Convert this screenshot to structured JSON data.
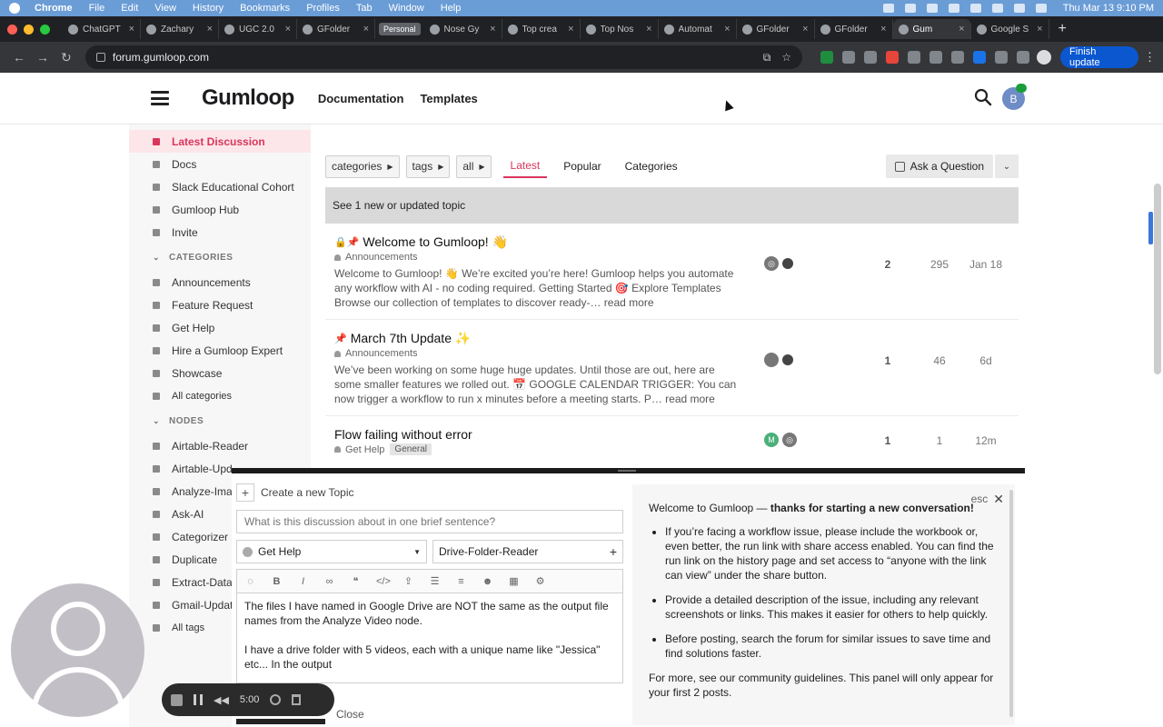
{
  "menubar": {
    "app": "Chrome",
    "items": [
      "File",
      "Edit",
      "View",
      "History",
      "Bookmarks",
      "Profiles",
      "Tab",
      "Window",
      "Help"
    ],
    "clock": "Thu Mar 13  9:10 PM"
  },
  "tabs": [
    {
      "label": "ChatGPT"
    },
    {
      "label": "Zachary"
    },
    {
      "label": "UGC 2.0"
    },
    {
      "label": "GFolder"
    },
    {
      "label": "Nose Gy"
    },
    {
      "label": "Top crea"
    },
    {
      "label": "Top Nos"
    },
    {
      "label": "Automat"
    },
    {
      "label": "GFolder"
    },
    {
      "label": "GFolder"
    },
    {
      "label": "Gum"
    },
    {
      "label": "Google S"
    }
  ],
  "tab_group_label": "Personal",
  "address": {
    "url": "forum.gumloop.com",
    "finish_update": "Finish update"
  },
  "header": {
    "logo": "Gumloop",
    "nav": [
      "Documentation",
      "Templates"
    ],
    "avatar_letter": "B"
  },
  "sidebar": {
    "top_items": [
      {
        "label": "Latest Discussion",
        "active": true
      },
      {
        "label": "Docs"
      },
      {
        "label": "Slack Educational Cohort"
      },
      {
        "label": "Gumloop Hub"
      },
      {
        "label": "Invite"
      }
    ],
    "categories_heading": "CATEGORIES",
    "categories": [
      "Announcements",
      "Feature Request",
      "Get Help",
      "Hire a Gumloop Expert",
      "Showcase"
    ],
    "all_categories": "All categories",
    "nodes_heading": "NODES",
    "nodes": [
      "Airtable-Reader",
      "Airtable-Upd",
      "Analyze-Imag",
      "Ask-AI",
      "Categorizer",
      "Duplicate",
      "Extract-Data",
      "Gmail-Update"
    ],
    "all_tags": "All tags"
  },
  "filters": {
    "chips": [
      "categories",
      "tags",
      "all"
    ],
    "tabs": [
      "Latest",
      "Popular",
      "Categories"
    ],
    "active_tab": "Latest",
    "ask_button": "Ask a Question"
  },
  "new_topics_banner": "See 1 new or updated topic",
  "topics": [
    {
      "title": "Welcome to Gumloop! 👋",
      "category": "Announcements",
      "excerpt": "Welcome to Gumloop! 👋 We’re excited you’re here! Gumloop helps you automate any workflow with AI - no coding required. Getting Started 🎯 Explore Templates Browse our collection of templates to discover ready-… read more",
      "replies": "2",
      "views": "295",
      "activity": "Jan 18"
    },
    {
      "title": "March 7th Update ✨",
      "category": "Announcements",
      "excerpt": "We’ve been working on some huge huge updates. Until those are out, here are some smaller features we rolled out. 📅 GOOGLE CALENDAR TRIGGER: You can now trigger a workflow to run x minutes before a meeting starts. P… read more",
      "replies": "1",
      "views": "46",
      "activity": "6d"
    },
    {
      "title": "Flow failing without error",
      "category": "Get Help",
      "tag": "General",
      "poster_letter": "M",
      "replies": "1",
      "views": "1",
      "activity": "12m"
    }
  ],
  "composer": {
    "heading": "Create a new Topic",
    "title_placeholder": "What is this discussion about in one brief sentence?",
    "category": "Get Help",
    "tag": "Drive-Folder-Reader",
    "body_lines": [
      "The files I have named in Google Drive are NOT the same as the output file names from the Analyze Video node.",
      "I have a drive folder with 5 videos, each with a unique name like \"Jessica\" etc... In the output"
    ],
    "close_label": "Close"
  },
  "guidance": {
    "esc": "esc",
    "intro": "Welcome to Gumloop — ",
    "intro_bold": "thanks for starting a new conversation!",
    "bullets": [
      "If you’re facing a workflow issue, please include the workbook or, even better, the run link with share access enabled. You can find the run link on the history page and set access to “anyone with the link can view” under the share button.",
      "Provide a detailed description of the issue, including any relevant screenshots or links. This makes it easier for others to help quickly.",
      "Before posting, search the forum for similar issues to save time and find solutions faster."
    ],
    "footer": "For more, see our community guidelines. This panel will only appear for your first 2 posts."
  },
  "recorder": {
    "time": "5:00"
  },
  "colors": {
    "accent": "#d9365b",
    "menubar": "#6a9cd6",
    "finish_button": "#0b57d0"
  }
}
